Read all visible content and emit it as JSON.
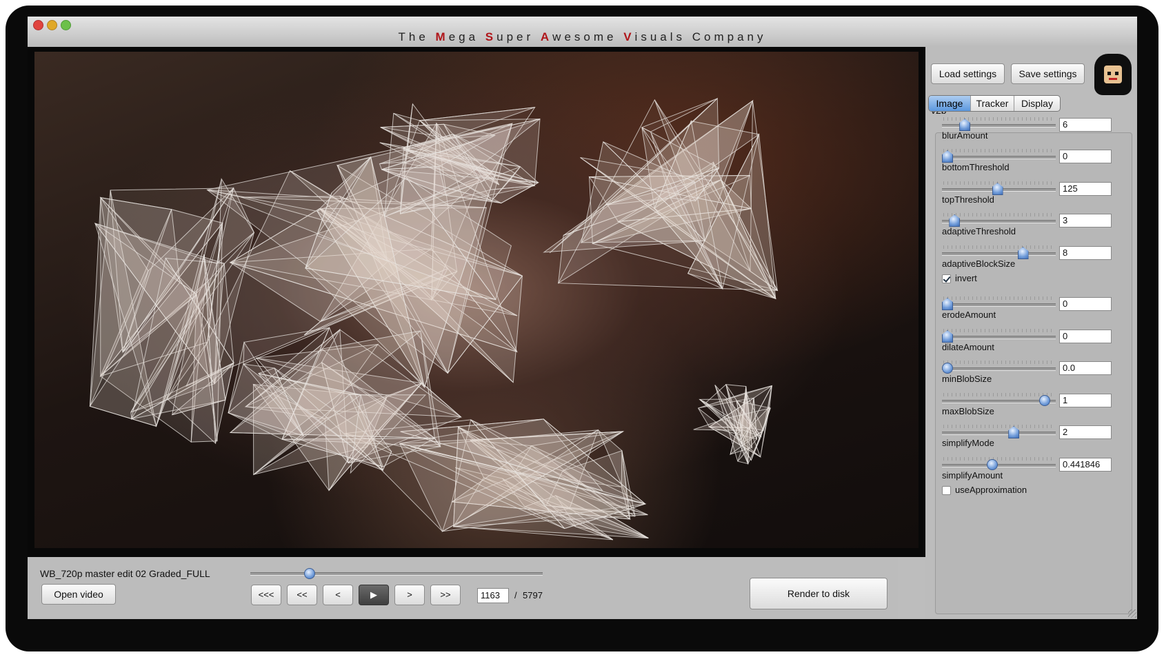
{
  "window": {
    "title_segments": [
      {
        "text": "The ",
        "hl": false
      },
      {
        "text": "M",
        "hl": true
      },
      {
        "text": "ega ",
        "hl": false
      },
      {
        "text": "S",
        "hl": true
      },
      {
        "text": "uper ",
        "hl": false
      },
      {
        "text": "A",
        "hl": true
      },
      {
        "text": "wesome ",
        "hl": false
      },
      {
        "text": "V",
        "hl": true
      },
      {
        "text": "isuals ",
        "hl": false
      },
      {
        "text": "Company",
        "hl": false
      }
    ]
  },
  "colors": {
    "title_highlight": "#b0151a",
    "accent_blue": "#5b97de",
    "mesh_stroke": "#e8e4e0"
  },
  "sidebar": {
    "load_label": "Load settings",
    "save_label": "Save settings",
    "version": "v2b",
    "avatar_icon": "pixel-avatar-icon",
    "tabs": [
      {
        "label": "Image",
        "active": true
      },
      {
        "label": "Tracker",
        "active": false
      },
      {
        "label": "Display",
        "active": false
      }
    ]
  },
  "params": [
    {
      "name": "blurAmount",
      "value": "6",
      "fraction": 0.17,
      "knob": "pointer"
    },
    {
      "name": "bottomThreshold",
      "value": "0",
      "fraction": 0.0,
      "knob": "pointer"
    },
    {
      "name": "topThreshold",
      "value": "125",
      "fraction": 0.49,
      "knob": "pointer"
    },
    {
      "name": "adaptiveThreshold",
      "value": "3",
      "fraction": 0.07,
      "knob": "pointer"
    },
    {
      "name": "adaptiveBlockSize",
      "value": "8",
      "fraction": 0.74,
      "knob": "pointer"
    },
    {
      "name": "erodeAmount",
      "value": "0",
      "fraction": 0.0,
      "knob": "pointer"
    },
    {
      "name": "dilateAmount",
      "value": "0",
      "fraction": 0.0,
      "knob": "pointer"
    },
    {
      "name": "minBlobSize",
      "value": "0.0",
      "fraction": 0.0,
      "knob": "round"
    },
    {
      "name": "maxBlobSize",
      "value": "1",
      "fraction": 0.95,
      "knob": "round"
    },
    {
      "name": "simplifyMode",
      "value": "2",
      "fraction": 0.65,
      "knob": "pointer"
    },
    {
      "name": "simplifyAmount",
      "value": "0.441846",
      "fraction": 0.44,
      "knob": "round"
    }
  ],
  "checks": {
    "invert": {
      "label": "invert",
      "checked": true
    },
    "use_approximation": {
      "label": "useApproximation",
      "checked": false
    }
  },
  "bottom": {
    "filename": "WB_720p master edit 02 Graded_FULL",
    "open_label": "Open video",
    "timeline_fraction": 0.2,
    "transport": [
      {
        "label": "<<<",
        "name": "first-frame-button",
        "active": false
      },
      {
        "label": "<<",
        "name": "rewind-button",
        "active": false
      },
      {
        "label": "<",
        "name": "step-back-button",
        "active": false
      },
      {
        "label": "▶",
        "name": "play-button",
        "active": true
      },
      {
        "label": ">",
        "name": "step-forward-button",
        "active": false
      },
      {
        "label": ">>",
        "name": "fast-forward-button",
        "active": false
      }
    ],
    "current_frame": "1163",
    "separator": "/",
    "total_frames": "5797",
    "render_label": "Render to disk"
  }
}
